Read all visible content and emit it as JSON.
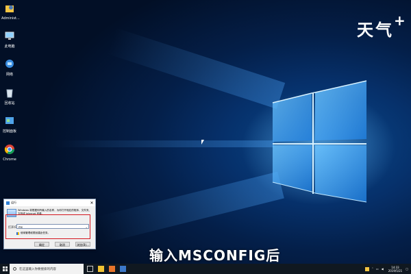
{
  "desktop": {
    "icons": [
      {
        "label": "Administ...",
        "icon": "user-folder-icon"
      },
      {
        "label": "此电脑",
        "icon": "computer-icon"
      },
      {
        "label": "网络",
        "icon": "network-icon"
      },
      {
        "label": "回收站",
        "icon": "recycle-bin-icon"
      },
      {
        "label": "控制面板",
        "icon": "control-panel-icon"
      },
      {
        "label": "Chrome",
        "icon": "chrome-icon"
      }
    ],
    "brand": "天气",
    "brand_plus": "+",
    "caption": "输入MSCONFIG后"
  },
  "run_dialog": {
    "title": "运行",
    "description": "Windows 将根据你所输入的名称，为你打开相应的程序、文件夹、文档或 Internet 资源。",
    "open_label": "打开(O):",
    "input_value": "ms",
    "admin_note": "使用管理权限创建此任务。",
    "ok_label": "确定",
    "cancel_label": "取消",
    "browse_label": "浏览(B)..."
  },
  "taskbar": {
    "search_placeholder": "在这里输入你要搜索的内容",
    "clock_time": "14:33",
    "clock_date": "2019/5/21"
  }
}
